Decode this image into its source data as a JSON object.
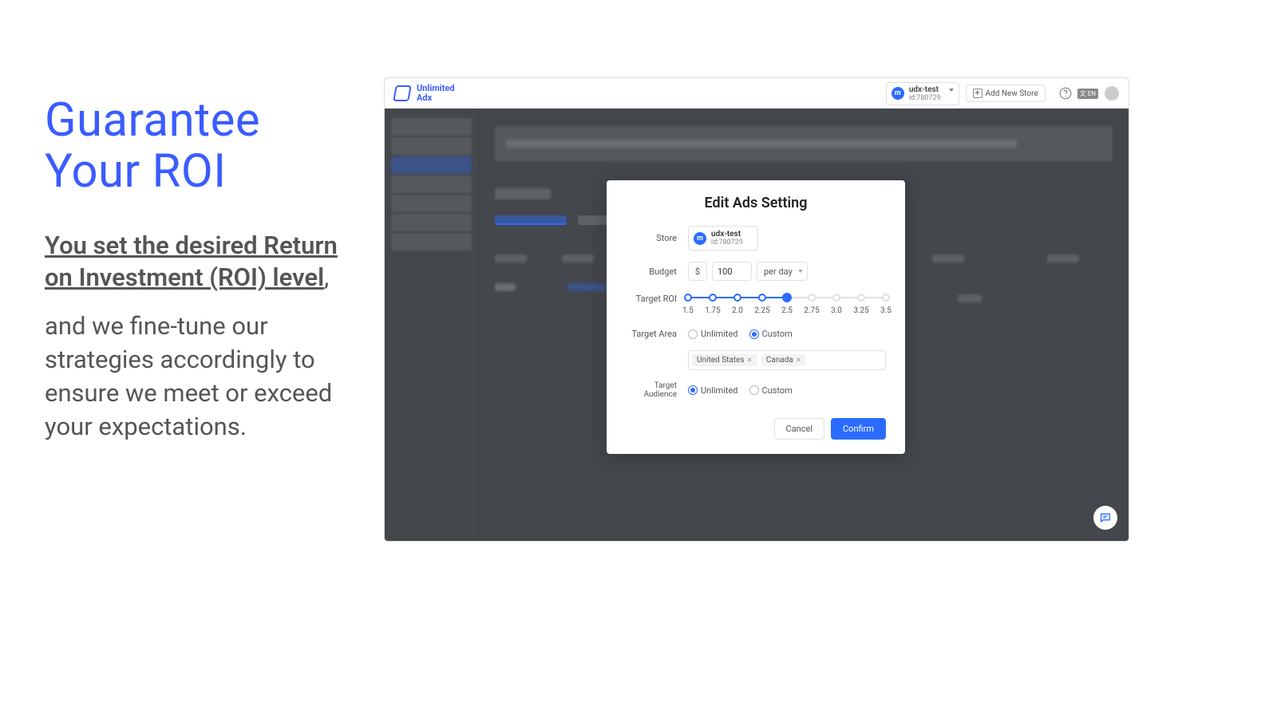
{
  "marketing": {
    "title": "Guarantee Your ROI",
    "sub_underlined": "You set the desired Return on Investment (ROI) level",
    "sub_tail": ",",
    "body": "and we fine-tune our strategies accordingly to ensure we meet or exceed your expectations."
  },
  "brand": {
    "name": "Unlimited\nAdx"
  },
  "topbar": {
    "store_name": "udx-test",
    "store_id": "id:780729",
    "add_store": "Add New Store"
  },
  "modal": {
    "title": "Edit Ads Setting",
    "labels": {
      "store": "Store",
      "budget": "Budget",
      "target_roi": "Target ROI",
      "target_area": "Target Area",
      "target_audience": "Target Audience"
    },
    "store": {
      "name": "udx-test",
      "id": "id:780729"
    },
    "budget": {
      "currency": "$",
      "amount": "100",
      "period": "per day"
    },
    "roi": {
      "steps": [
        "1.5",
        "1.75",
        "2.0",
        "2.25",
        "2.5",
        "2.75",
        "3.0",
        "3.25",
        "3.5"
      ],
      "selected_index": 4
    },
    "target_area": {
      "options": {
        "unlimited": "Unlimited",
        "custom": "Custom"
      },
      "selected": "custom",
      "tags": [
        "United States",
        "Canada"
      ]
    },
    "target_audience": {
      "options": {
        "unlimited": "Unlimited",
        "custom": "Custom"
      },
      "selected": "unlimited"
    },
    "buttons": {
      "cancel": "Cancel",
      "confirm": "Confirm"
    }
  }
}
